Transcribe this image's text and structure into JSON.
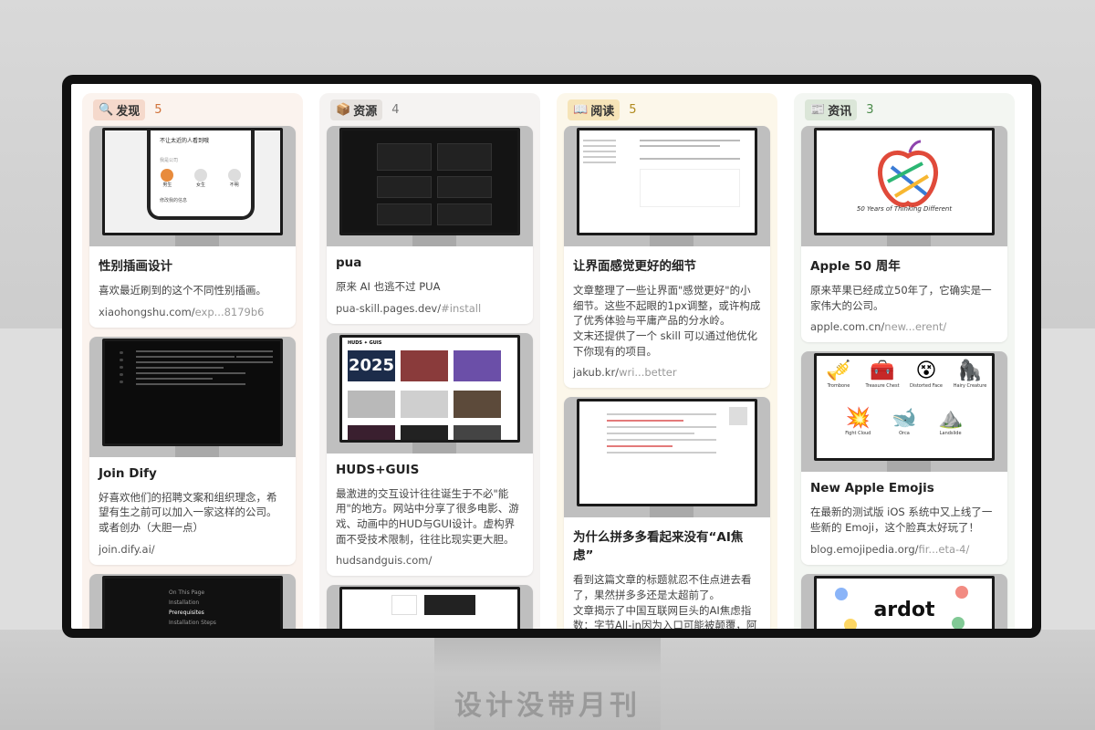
{
  "watermark": "设计没带月刊",
  "columns": [
    {
      "icon": "🔍",
      "tag": "发现",
      "count": "5",
      "cards": [
        {
          "title": "性别插画设计",
          "desc": "喜欢最近刷到的这个不同性别插画。",
          "link_main": "xiaohongshu.com/",
          "link_dim": "exp...8179b6",
          "thumb": {
            "heading": "不让太近的人看到哦",
            "section": "我是公司",
            "labels": [
              "男生",
              "女生",
              "不明"
            ],
            "footer": "修改我的信息"
          }
        },
        {
          "title": "Join Dify",
          "desc": "好喜欢他们的招聘文案和组织理念，希望有生之前可以加入一家这样的公司。\n或者创办（大胆一点）",
          "link_main": "join.dify.ai/",
          "link_dim": ""
        },
        {
          "title": "",
          "desc": "",
          "link_main": "",
          "link_dim": "",
          "thumb": {
            "items": [
              "On This Page",
              "Installation",
              "Prerequisites",
              "Installation Steps"
            ]
          }
        }
      ]
    },
    {
      "icon": "📦",
      "tag": "资源",
      "count": "4",
      "cards": [
        {
          "title": "pua",
          "desc": "原来 AI 也逃不过 PUA",
          "link_main": "pua-skill.pages.dev/",
          "link_dim": "#install"
        },
        {
          "title": "HUDS+GUIS",
          "desc": "最激进的交互设计往往诞生于不必\"能用\"的地方。网站中分享了很多电影、游戏、动画中的HUD与GUI设计。虚构界面不受技术限制，往往比现实更大胆。",
          "link_main": "hudsandguis.com/",
          "link_dim": "",
          "thumb": {
            "brand": "HUDS ✦ GUIS",
            "big": "2025"
          }
        },
        {
          "title": "",
          "desc": "",
          "link_main": "",
          "link_dim": ""
        }
      ]
    },
    {
      "icon": "📖",
      "tag": "阅读",
      "count": "5",
      "cards": [
        {
          "title": "让界面感觉更好的细节",
          "desc": "文章整理了一些让界面\"感觉更好\"的小细节。这些不起眼的1px调整，或许构成了优秀体验与平庸产品的分水岭。\n文末还提供了一个 skill 可以通过他优化下你现有的项目。",
          "link_main": "jakub.kr/",
          "link_dim": "wri...better"
        },
        {
          "title": "为什么拼多多看起来没有“AI焦虑”",
          "desc": "看到这篇文章的标题就忍不住点进去看了，果然拼多多还是太超前了。\n文章揭示了中国互联网巨头的AI焦虑指数：字节All-in因为入口可能被颠覆，阿里押注基础设施，腾讯基本盘稳固从容布局，而拼多",
          "link_main": "",
          "link_dim": ""
        }
      ]
    },
    {
      "icon": "📰",
      "tag": "资讯",
      "count": "3",
      "cards": [
        {
          "title": "Apple  50 周年",
          "desc": "原来苹果已经成立50年了，它确实是一家伟大的公司。",
          "link_main": "apple.com.cn/",
          "link_dim": "new...erent/",
          "thumb": {
            "caption": "50 Years of Thinking Different"
          }
        },
        {
          "title": "New Apple Emojis",
          "desc": "在最新的测试版 iOS 系统中又上线了一些新的 Emoji，这个脸真太好玩了！",
          "link_main": "blog.emojipedia.org/",
          "link_dim": "fir...eta-4/",
          "thumb": {
            "emojis": [
              {
                "glyph": "🎺",
                "label": "Trombone"
              },
              {
                "glyph": "🧰",
                "label": "Treasure Chest"
              },
              {
                "glyph": "😵",
                "label": "Distorted Face"
              },
              {
                "glyph": "🦍",
                "label": "Hairy Creature"
              },
              {
                "glyph": "💥",
                "label": "Fight Cloud"
              },
              {
                "glyph": "🐋",
                "label": "Orca"
              },
              {
                "glyph": "⛰️",
                "label": "Landslide"
              }
            ]
          }
        },
        {
          "title": "",
          "desc": "",
          "link_main": "",
          "link_dim": "",
          "thumb": {
            "brand": "ardot"
          }
        }
      ]
    }
  ]
}
